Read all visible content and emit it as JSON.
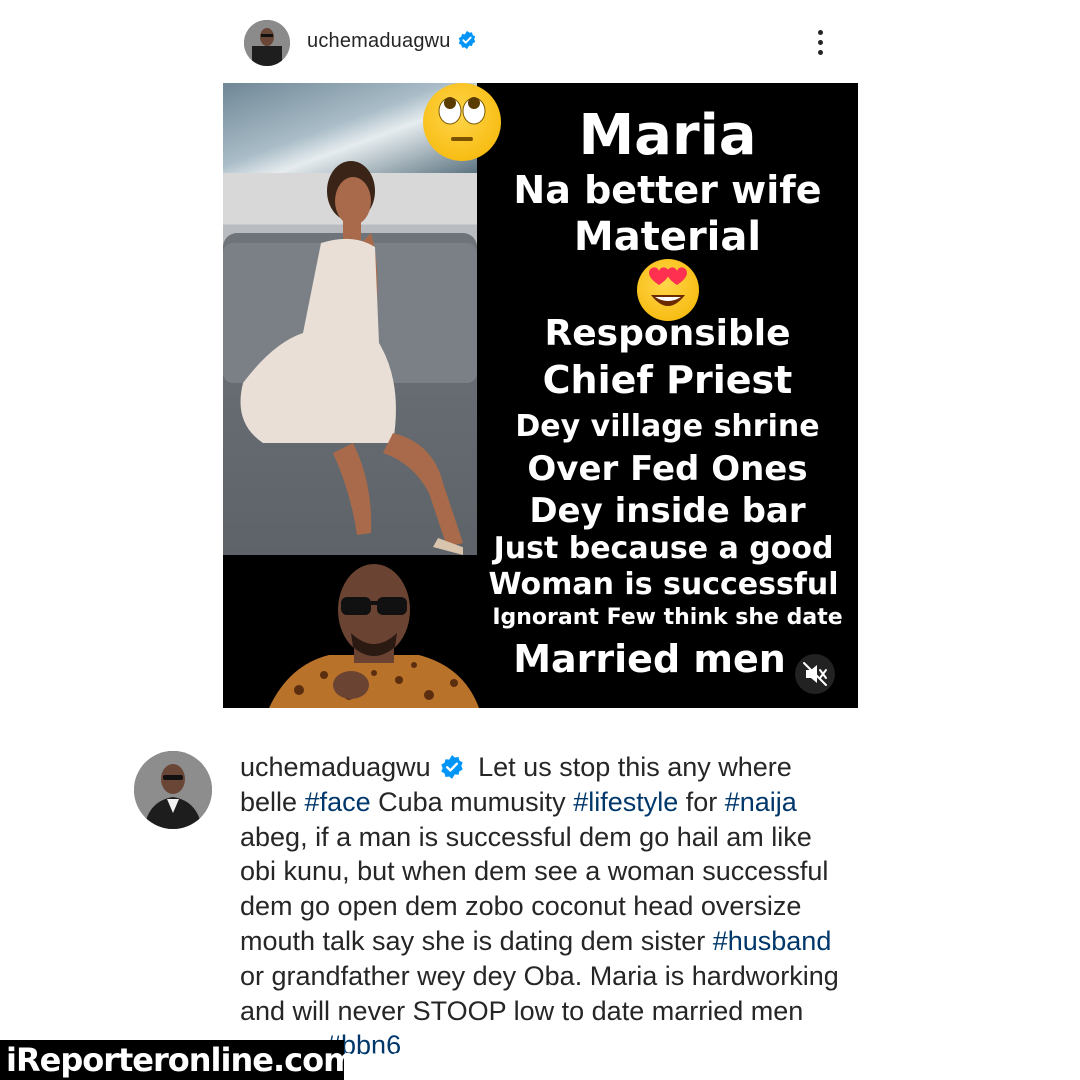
{
  "header": {
    "username": "uchemaduagwu",
    "more_icon": "more-vertical-icon"
  },
  "media": {
    "lines": [
      "Maria",
      "Na better wife",
      "Material",
      "Responsible",
      "Chief  Priest",
      "Dey village shrine",
      "Over  Fed Ones",
      "Dey inside bar",
      "Just because a good",
      "Woman is successful",
      "Ignorant  Few think she date",
      "Married men"
    ],
    "emoji_top": "face-with-rolling-eyes",
    "emoji_middle": "smiling-face-with-heart-eyes",
    "mute_icon": "speaker-muted-icon"
  },
  "caption": {
    "username": "uchemaduagwu",
    "line1_text": " Let us stop this any where",
    "line2_a": "belle ",
    "tag_face": "#face",
    "line2_b": " Cuba mumusity ",
    "tag_lifestyle": "#lifestyle",
    "line2_c": " for ",
    "tag_naija": "#naija",
    "line3": "abeg, if a man is successful dem go hail am like",
    "line4": "obi kunu, but when dem see a woman successful",
    "line5": "dem go open dem zobo coconut head oversize",
    "line6_a": "mouth talk say she is dating dem sister ",
    "tag_husband": "#husband",
    "line7": "or grandfather wey dey Oba. Maria is hardworking",
    "line8": "and will never STOOP low to date married men",
    "tag_bbn6": "#bbn6"
  },
  "watermark": {
    "text": "iReporteronline.com.ng"
  },
  "colors": {
    "verified_blue": "#0095f6",
    "hashtag": "#00376b",
    "text": "#262626"
  }
}
